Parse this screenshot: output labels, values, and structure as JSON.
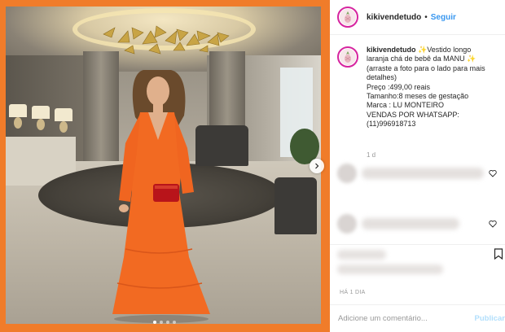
{
  "post": {
    "username": "kikivendetudo",
    "follow_label": "Seguir",
    "separator": "•",
    "caption": {
      "username": "kikivendetudo",
      "lines": [
        "✨Vestido longo",
        "laranja chá de bebê da MANU ✨",
        "(arraste a foto para o lado para mais",
        "detalhes)",
        "Preço :499,00 reais",
        "Tamanho:8 meses de gestação",
        "Marca : LU MONTEIRO",
        "VENDAS POR WHATSAPP:",
        "(11)996918713"
      ],
      "time": "1 d"
    },
    "age": "HÁ 1 DIA",
    "add_comment_placeholder": "Adicione um comentário...",
    "publish_label": "Publicar"
  },
  "carousel": {
    "slide_count": 4,
    "active_index": 0
  },
  "colors": {
    "frame_orange": "#f07c2a",
    "dress_orange": "#f26a22",
    "link_blue": "#3897f0",
    "publish_disabled": "#b2dffc",
    "avatar_ring": "#d6249f"
  },
  "icons": {
    "next": "chevron-right-icon",
    "heart": "heart-outline-icon",
    "bookmark": "bookmark-icon",
    "avatar": "pineapple-logo-icon"
  }
}
